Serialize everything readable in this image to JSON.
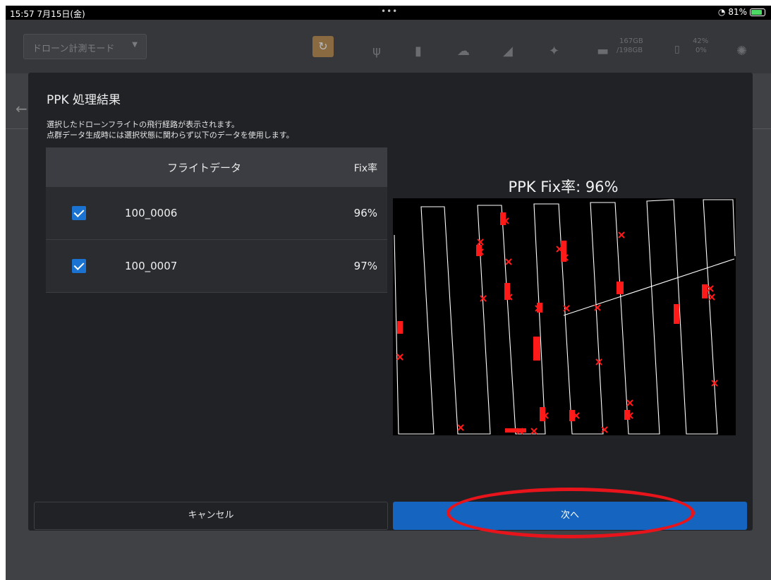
{
  "status_bar": {
    "time": "15:57",
    "date": "7月15日(金)",
    "dots": "•••",
    "battery": "81%"
  },
  "toolbar": {
    "mode_label": "ドローン計測モード",
    "storage_used": "167GB",
    "storage_total": "/198GB",
    "battery_top": "42%",
    "battery_bottom": "0%"
  },
  "modal": {
    "title": "PPK 処理結果",
    "desc_line1": "選択したドローンフライトの飛行経路が表示されます。",
    "desc_line2": "点群データ生成時には選択状態に関わらず以下のデータを使用します。",
    "table": {
      "headers": {
        "flight": "フライトデータ",
        "fix": "Fix率"
      },
      "rows": [
        {
          "name": "100_0006",
          "fix": "96%",
          "checked": true
        },
        {
          "name": "100_0007",
          "fix": "97%",
          "checked": true
        }
      ]
    },
    "plot_title": "PPK Fix率: 96%",
    "cancel_label": "キャンセル",
    "next_label": "次へ"
  },
  "colors": {
    "accent_blue": "#1565c0",
    "checkbox_blue": "#1a73d1",
    "marker_red": "#ff0000",
    "annotation_red": "#e8141b",
    "path_white": "#ffffff"
  }
}
